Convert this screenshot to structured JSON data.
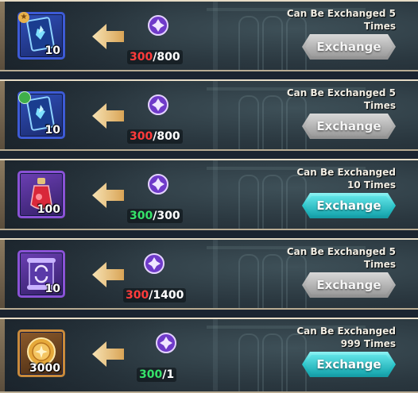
{
  "colors": {
    "insufficient": "#ff3b3b",
    "enough": "#36e36a",
    "button_active": "#2cc7cc",
    "button_disabled": "#a9a9a9"
  },
  "rows": [
    {
      "item_icon": "blue-card-icon",
      "corner_badge": "star-icon",
      "quantity": "10",
      "cost_have": "300",
      "cost_need": "/800",
      "affordable": false,
      "limit_line1": "Can Be Exchanged 5",
      "limit_line2": "Times",
      "button_label": "Exchange",
      "button_enabled": false
    },
    {
      "item_icon": "blue-card-icon",
      "corner_badge": "green-dot-icon",
      "quantity": "10",
      "cost_have": "300",
      "cost_need": "/800",
      "affordable": false,
      "limit_line1": "Can Be Exchanged 5",
      "limit_line2": "Times",
      "button_label": "Exchange",
      "button_enabled": false
    },
    {
      "item_icon": "potion-icon",
      "corner_badge": "",
      "quantity": "100",
      "cost_have": "300",
      "cost_need": "/300",
      "affordable": true,
      "limit_line1": "Can Be Exchanged",
      "limit_line2": "10 Times",
      "button_label": "Exchange",
      "button_enabled": true
    },
    {
      "item_icon": "scroll-icon",
      "corner_badge": "",
      "quantity": "10",
      "cost_have": "300",
      "cost_need": "/1400",
      "affordable": false,
      "limit_line1": "Can Be Exchanged 5",
      "limit_line2": "Times",
      "button_label": "Exchange",
      "button_enabled": false
    },
    {
      "item_icon": "gold-coin-icon",
      "corner_badge": "",
      "quantity": "3000",
      "cost_have": "300",
      "cost_need": "/1",
      "affordable": true,
      "limit_line1": "Can Be Exchanged",
      "limit_line2": "999 Times",
      "button_label": "Exchange",
      "button_enabled": true
    }
  ]
}
